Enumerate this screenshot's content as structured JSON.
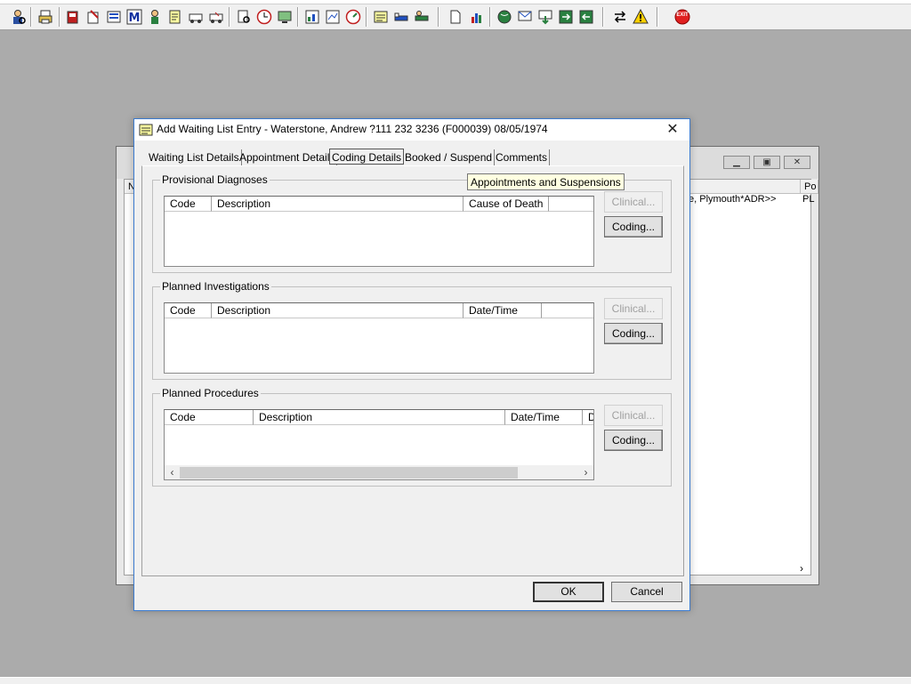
{
  "toolbar": {
    "icons": [
      "user-search-icon",
      "print-icon",
      "book-icon",
      "notes-icon",
      "list-icon",
      "m-icon",
      "person-icon",
      "edit-icon",
      "transport-icon",
      "transport2-icon",
      "search-doc-icon",
      "clock-icon",
      "monitor-icon",
      "chart-icon",
      "document-chart-icon",
      "dial-icon",
      "notepad-icon",
      "bed-icon",
      "bed2-icon",
      "page-icon",
      "bar-chart-icon",
      "globe-icon",
      "message-icon",
      "down-icon",
      "green-arrows-icon",
      "swap-icon",
      "warning-icon",
      "exit-icon"
    ],
    "exit_label": "EXIT"
  },
  "background_window": {
    "row_text": "e, Plymouth*ADR>>",
    "col_first": "N",
    "col_last": "Po",
    "cell_last": "PL"
  },
  "dialog": {
    "title": "Add Waiting List Entry - Waterstone, Andrew ?111 232 3236 (F000039) 08/05/1974",
    "tabs": [
      {
        "label": "Waiting List Details"
      },
      {
        "label": "Appointment Details"
      },
      {
        "label": "Coding Details"
      },
      {
        "label": "Booked / Suspend"
      },
      {
        "label": "Comments"
      }
    ],
    "active_tab": "Coding Details",
    "groups": {
      "diagnoses": {
        "title": "Provisional Diagnoses",
        "columns": [
          "Code",
          "Description",
          "Cause of Death"
        ],
        "clinical_label": "Clinical...",
        "coding_label": "Coding..."
      },
      "investigations": {
        "title": "Planned Investigations",
        "columns": [
          "Code",
          "Description",
          "Date/Time"
        ],
        "clinical_label": "Clinical...",
        "coding_label": "Coding..."
      },
      "procedures": {
        "title": "Planned Procedures",
        "columns": [
          "Code",
          "Description",
          "Date/Time",
          "D"
        ],
        "clinical_label": "Clinical...",
        "coding_label": "Coding..."
      }
    },
    "ok_label": "OK",
    "cancel_label": "Cancel"
  },
  "tooltip": "Appointments and Suspensions",
  "colors": {
    "desktop": "#ababab",
    "dialog_border": "#3b7bd0",
    "tooltip_bg": "#ffffe1"
  }
}
